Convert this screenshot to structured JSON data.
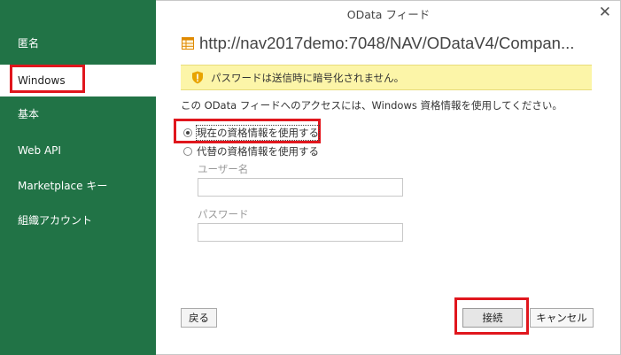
{
  "sidebar": {
    "items": [
      {
        "label": "匿名"
      },
      {
        "label": "Windows"
      },
      {
        "label": "基本"
      },
      {
        "label": "Web API"
      },
      {
        "label": "Marketplace キー"
      },
      {
        "label": "組織アカウント"
      }
    ],
    "selected_index": 1
  },
  "dialog": {
    "title": "OData フィード",
    "close_glyph": "✕",
    "url": "http://nav2017demo:7048/NAV/ODataV4/Compan...",
    "warning": "パスワードは送信時に暗号化されません。",
    "description": "この OData フィードへのアクセスには、Windows 資格情報を使用してください。",
    "options": [
      {
        "label": "現在の資格情報を使用する",
        "checked": true
      },
      {
        "label": "代替の資格情報を使用する",
        "checked": false
      }
    ],
    "username_label": "ユーザー名",
    "password_label": "パスワード",
    "username_value": "",
    "password_value": ""
  },
  "buttons": {
    "back": "戻る",
    "connect": "接続",
    "cancel": "キャンセル"
  },
  "colors": {
    "sidebar_bg": "#217346",
    "highlight": "#e0161d",
    "warning_bg": "#fcf5a8"
  },
  "icons": {
    "url": "table-icon",
    "warning": "shield-warning-icon",
    "close": "close-icon"
  }
}
